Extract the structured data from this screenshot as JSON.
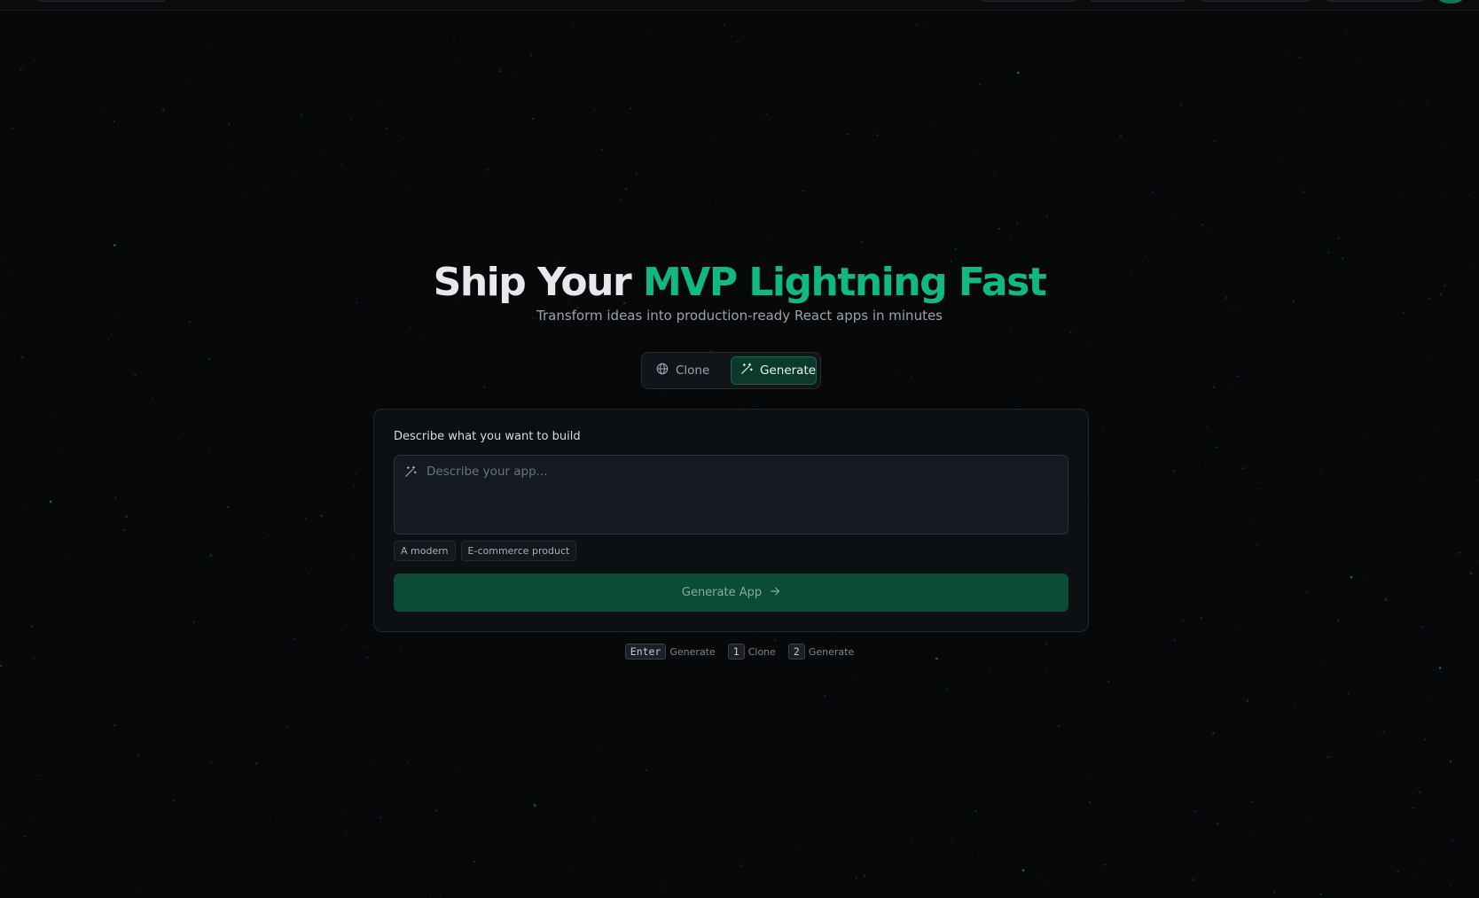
{
  "hero": {
    "title_prefix": "Ship Your ",
    "title_highlight": "MVP Lightning Fast",
    "subtitle": "Transform ideas into production-ready React apps in minutes"
  },
  "mode_toggle": {
    "clone_label": "Clone",
    "generate_label": "Generate",
    "active": "Generate"
  },
  "form": {
    "label": "Describe what you want to build",
    "placeholder": "Describe your app...",
    "value": "",
    "suggestions": [
      "A modern",
      "E-commerce product"
    ],
    "submit_label": "Generate App"
  },
  "shortcuts": [
    {
      "key": "Enter",
      "action": "Generate"
    },
    {
      "key": "1",
      "action": "Clone"
    },
    {
      "key": "2",
      "action": "Generate"
    }
  ],
  "colors": {
    "accent": "#10b981",
    "background": "#06080a",
    "button": "#0b4c37"
  },
  "icons": [
    "globe-icon",
    "magic-wand-icon",
    "arrow-right-icon"
  ]
}
